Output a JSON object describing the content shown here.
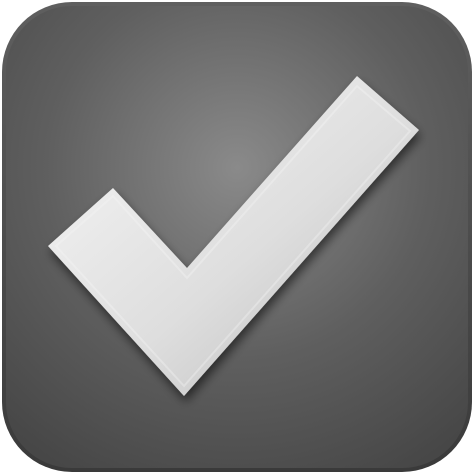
{
  "icon": {
    "name": "check-mark-icon",
    "shape": "rounded-square",
    "colors": {
      "tile_light": "#8a8a8a",
      "tile_mid": "#5f5f5f",
      "tile_dark": "#474747",
      "tile_edge": "#3a3a3a",
      "check_light": "#f7f7f7",
      "check_mid": "#dedede",
      "check_dark": "#b7b7b7",
      "check_shadow": "#202020"
    }
  }
}
